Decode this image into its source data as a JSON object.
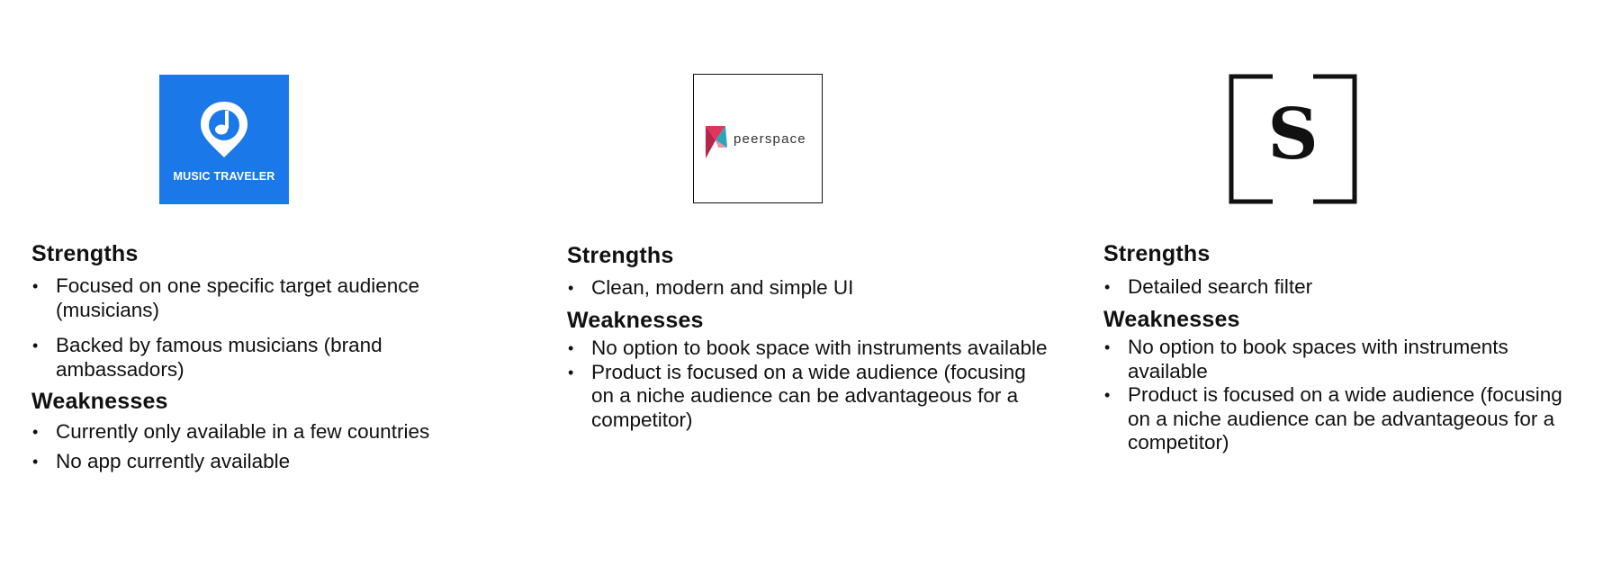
{
  "columns": [
    {
      "logo": {
        "name": "Music Traveler",
        "text": "MUSIC TRAVELER",
        "color": "#1b78e8"
      },
      "strengths_heading": "Strengths",
      "strengths": [
        "Focused on one specific target audience (musicians)",
        "Backed by famous musicians (brand ambassadors)"
      ],
      "weaknesses_heading": "Weaknesses",
      "weaknesses": [
        "Currently only available in a few countries",
        "No app currently available"
      ]
    },
    {
      "logo": {
        "name": "peerspace",
        "text": "peerspace",
        "color": "#e0365c"
      },
      "strengths_heading": "Strengths",
      "strengths": [
        "Clean, modern and simple UI"
      ],
      "weaknesses_heading": "Weaknesses",
      "weaknesses": [
        "No option to book space with instruments available",
        "Product is focused on a wide audience (focusing on a niche audience can be advantageous for a competitor)"
      ]
    },
    {
      "logo": {
        "name": "S bracket logo",
        "text": "S",
        "color": "#111111"
      },
      "strengths_heading": "Strengths",
      "strengths": [
        "Detailed search filter"
      ],
      "weaknesses_heading": "Weaknesses",
      "weaknesses": [
        "No option to book spaces with instruments available",
        "Product is focused on a wide audience (focusing on a niche audience can be advantageous for a competitor)"
      ]
    }
  ]
}
